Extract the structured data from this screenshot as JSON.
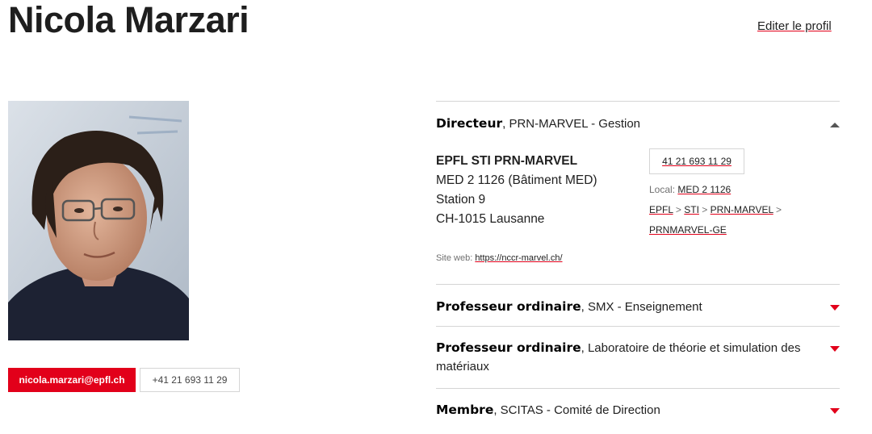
{
  "person": {
    "name": "Nicola Marzari",
    "edit_profile": "Editer le profil",
    "email": "nicola.marzari@epfl.ch",
    "phone": "+41 21 693 11 29"
  },
  "accordion": [
    {
      "role": "Directeur",
      "unit": ", PRN-MARVEL - Gestion",
      "expanded": true,
      "address": {
        "org": "EPFL STI PRN-MARVEL",
        "line1": "MED 2 1126 (Bâtiment MED)",
        "line2": "Station 9",
        "line3": "CH-1015 Lausanne"
      },
      "office_phone": "41 21 693 11 29",
      "local_label": "Local:",
      "local_room": "MED 2 1126",
      "path": [
        "EPFL",
        "STI",
        "PRN-MARVEL",
        "PRNMARVEL-GE"
      ],
      "path_separator": ">",
      "website_label": "Site web:",
      "website_url": "https://nccr-marvel.ch/"
    },
    {
      "role": "Professeur ordinaire",
      "unit": ", SMX - Enseignement",
      "expanded": false
    },
    {
      "role": "Professeur ordinaire",
      "unit": ", Laboratoire de théorie et simulation des matériaux",
      "expanded": false
    },
    {
      "role": "Membre",
      "unit": ", SCITAS - Comité de Direction",
      "expanded": false
    }
  ],
  "icons": {
    "expanded": "triangle-up-icon",
    "collapsed": "triangle-down-icon"
  },
  "colors": {
    "accent": "#e2001a",
    "text": "#212121",
    "border": "#d5d5d5"
  }
}
